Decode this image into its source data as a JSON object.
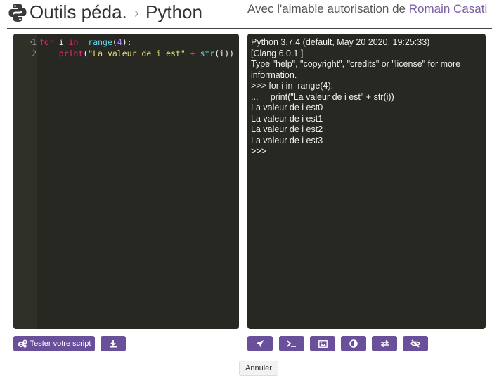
{
  "header": {
    "title": "Outils péda.",
    "separator": "›",
    "subtitle": "Python",
    "credit_prefix": "Avec l'aimable autorisation de ",
    "credit_author": "Romain Casati",
    "logo_icon": "python-logo-icon"
  },
  "editor": {
    "lines": [
      {
        "number": "1",
        "tokens": [
          {
            "t": "for",
            "c": "kw"
          },
          {
            "t": " i ",
            "c": ""
          },
          {
            "t": "in",
            "c": "kw"
          },
          {
            "t": "  ",
            "c": ""
          },
          {
            "t": "range",
            "c": "fn"
          },
          {
            "t": "(",
            "c": ""
          },
          {
            "t": "4",
            "c": "num"
          },
          {
            "t": "):",
            "c": ""
          }
        ]
      },
      {
        "number": "2",
        "tokens": [
          {
            "t": "    ",
            "c": ""
          },
          {
            "t": "print",
            "c": "kw"
          },
          {
            "t": "(",
            "c": ""
          },
          {
            "t": "\"La valeur de i est\"",
            "c": "str"
          },
          {
            "t": " ",
            "c": ""
          },
          {
            "t": "+",
            "c": "kw"
          },
          {
            "t": " ",
            "c": ""
          },
          {
            "t": "str",
            "c": "fn"
          },
          {
            "t": "(i))",
            "c": ""
          }
        ]
      }
    ]
  },
  "console": {
    "lines": [
      "Python 3.7.4 (default, May 20 2020, 19:25:33)",
      "[Clang 6.0.1 ]",
      "Type \"help\", \"copyright\", \"credits\" or \"license\" for more information.",
      ">>> for i in  range(4):",
      "...     print(\"La valeur de i est\" + str(i))",
      "La valeur de i est0",
      "La valeur de i est1",
      "La valeur de i est2",
      "La valeur de i est3"
    ],
    "prompt": ">>> "
  },
  "buttons": {
    "test_script": "Tester votre script",
    "test_icon": "gears-icon",
    "download_icon": "download-icon",
    "console_tools": [
      {
        "name": "run-button",
        "icon": "rocket-icon"
      },
      {
        "name": "terminal-button",
        "icon": "terminal-icon"
      },
      {
        "name": "image-button",
        "icon": "image-icon"
      },
      {
        "name": "contrast-button",
        "icon": "contrast-icon"
      },
      {
        "name": "swap-button",
        "icon": "swap-icon"
      },
      {
        "name": "hide-button",
        "icon": "eye-slash-icon"
      }
    ],
    "cancel": "Annuler"
  },
  "colors": {
    "accent": "#6a4f9b",
    "editor_bg": "#272822",
    "author_link": "#7a5fa3"
  }
}
